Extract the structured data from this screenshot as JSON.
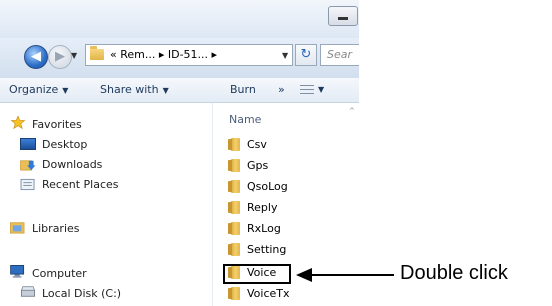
{
  "window": {
    "address": {
      "path_text": "« Rem... ▸ ID-51... ▸",
      "search_placeholder": "Sear"
    },
    "toolbar": {
      "organize": "Organize",
      "share_with": "Share with",
      "burn": "Burn",
      "overflow": "»"
    },
    "sidebar": {
      "favorites": "Favorites",
      "desktop": "Desktop",
      "downloads": "Downloads",
      "recent_places": "Recent Places",
      "libraries": "Libraries",
      "computer": "Computer",
      "local_disk": "Local Disk (C:)"
    },
    "main": {
      "column_header": "Name",
      "files": [
        "Csv",
        "Gps",
        "QsoLog",
        "Reply",
        "RxLog",
        "Setting",
        "Voice",
        "VoiceTx"
      ],
      "selected": "Voice"
    }
  },
  "annotation": {
    "label": "Double click"
  },
  "icons": {
    "back": "back-arrow-icon",
    "forward": "forward-arrow-icon",
    "refresh": "refresh-icon",
    "folder": "folder-icon",
    "favorites": "star-icon",
    "desktop": "desktop-icon",
    "downloads": "downloads-icon",
    "recent": "recent-places-icon",
    "libraries": "libraries-icon",
    "computer": "computer-icon",
    "disk": "disk-icon"
  },
  "colors": {
    "toolbar_text": "#1e395b",
    "folder": "#f3cf6a"
  }
}
